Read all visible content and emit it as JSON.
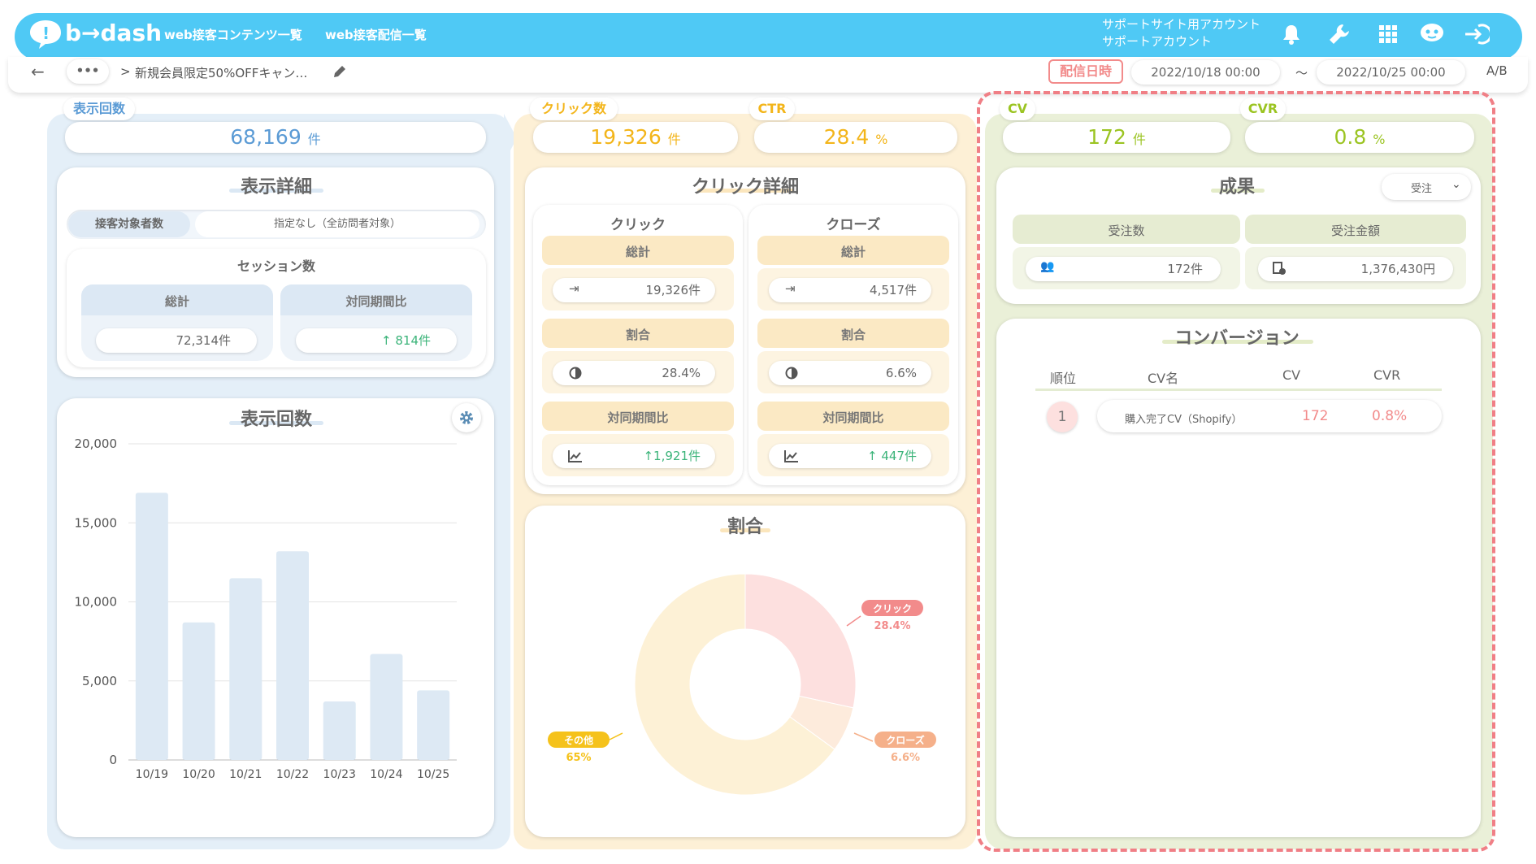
{
  "header": {
    "logo": "b→dash",
    "nav": [
      "web接客コンテンツ一覧",
      "web接客配信一覧"
    ],
    "account_line1": "サポートサイト用アカウント",
    "account_line2": "サポートアカウント",
    "icons": [
      "bell-icon",
      "wrench-icon",
      "grid-icon",
      "chat-bot-icon",
      "logout-icon"
    ]
  },
  "breadcrumb": {
    "more": "•••",
    "separator": ">",
    "current": "新規会員限定50%OFFキャン…",
    "schedule_label": "配信日時",
    "start": "2022/10/18 00:00",
    "tilde": "〜",
    "end": "2022/10/25 00:00",
    "ab": "A/B"
  },
  "colA": {
    "tag": "表示回数",
    "kpi_value": "68,169",
    "kpi_unit": "件",
    "detail": {
      "title": "表示詳細",
      "seg_active": "接客対象者数",
      "seg_value": "指定なし（全訪問者対象）",
      "session_title": "セッション数",
      "col1": "総計",
      "col2": "対同期間比",
      "val1": "72,314件",
      "val2": "↑ 814件"
    },
    "chart_title": "表示回数"
  },
  "chart_data": {
    "type": "bar",
    "title": "表示回数",
    "categories": [
      "10/19",
      "10/20",
      "10/21",
      "10/22",
      "10/23",
      "10/24",
      "10/25"
    ],
    "values": [
      16900,
      8700,
      11500,
      13200,
      3700,
      6700,
      4400
    ],
    "ylim": [
      0,
      20000
    ],
    "yticks": [
      "20,000",
      "15,000",
      "10,000",
      "5,000",
      "0"
    ],
    "color": "#dde9f4",
    "grid": true
  },
  "colB": {
    "tag_click": "クリック数",
    "kpi_click": "19,326",
    "kpi_click_unit": "件",
    "tag_ctr": "CTR",
    "kpi_ctr": "28.4",
    "kpi_ctr_unit": "%",
    "detail_title": "クリック詳細",
    "click": {
      "title": "クリック",
      "total_label": "総計",
      "total": "19,326件",
      "ratio_label": "割合",
      "ratio": "28.4%",
      "compare_label": "対同期間比",
      "compare": "↑1,921件"
    },
    "close": {
      "title": "クローズ",
      "total_label": "総計",
      "total": "4,517件",
      "ratio_label": "割合",
      "ratio": "6.6%",
      "compare_label": "対同期間比",
      "compare": "↑ 447件"
    },
    "donut": {
      "title": "割合",
      "segments": [
        {
          "name": "クリック",
          "value": 28.4,
          "label": "28.4%",
          "color": "#fde0df",
          "tagcolor": "#f28b8b"
        },
        {
          "name": "クローズ",
          "value": 6.6,
          "label": "6.6%",
          "color": "#fdebdc",
          "tagcolor": "#f5b08a"
        },
        {
          "name": "その他",
          "value": 65,
          "label": "65%",
          "color": "#fdf1d6",
          "tagcolor": "#f5c21b"
        }
      ]
    }
  },
  "colC": {
    "tag_cv": "CV",
    "kpi_cv": "172",
    "kpi_cv_unit": "件",
    "tag_cvr": "CVR",
    "kpi_cvr": "0.8",
    "kpi_cvr_unit": "%",
    "result_title": "成果",
    "select_value": "受注",
    "orders_label": "受注数",
    "orders": "172件",
    "amount_label": "受注金額",
    "amount": "1,376,430円",
    "conv_title": "コンバージョン",
    "table_headers": [
      "順位",
      "CV名",
      "CV",
      "CVR"
    ],
    "rows": [
      {
        "rank": "1",
        "name": "購入完了CV（Shopify）",
        "cv": "172",
        "cvr": "0.8%"
      }
    ]
  }
}
